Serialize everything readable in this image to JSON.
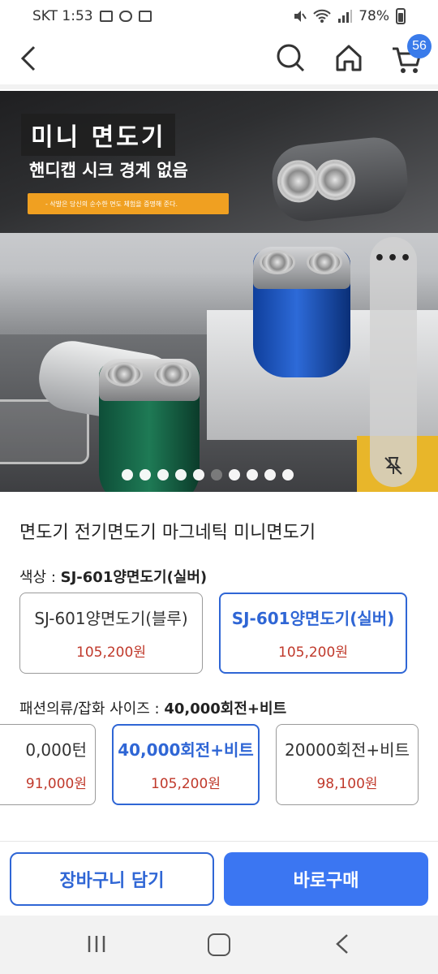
{
  "status_bar": {
    "carrier_time": "SKT 1:53",
    "battery": "78%"
  },
  "header": {
    "cart_count": "56"
  },
  "banner": {
    "title": "미니 면도기",
    "subtitle": "핸디캡 시크 경계 없음",
    "tagline": "- 삭발은 당신의 순수한 면도 체험을 증명해 준다.",
    "more_menu": "•••",
    "carousel_active_index": 5,
    "carousel_total": 10
  },
  "product": {
    "title": "면도기 전기면도기 마그네틱 미니면도기"
  },
  "color_option": {
    "label": "색상 : ",
    "selected": "SJ-601양면도기(실버)",
    "choices": [
      {
        "name": "SJ-601양면도기(블루)",
        "price": "105,200원"
      },
      {
        "name": "SJ-601양면도기(실버)",
        "price": "105,200원"
      }
    ]
  },
  "size_option": {
    "label": "패션의류/잡화 사이즈 : ",
    "selected": "40,000회전+비트",
    "choices": [
      {
        "name": "0,000턴",
        "price": "91,000원"
      },
      {
        "name": "40,000회전+비트",
        "price": "105,200원"
      },
      {
        "name": "20000회전+비트",
        "price": "98,100원"
      }
    ]
  },
  "actions": {
    "add_to_cart": "장바구니 담기",
    "buy_now": "바로구매"
  },
  "colors": {
    "accent": "#2f66d5",
    "buy_button": "#3b76f2",
    "price": "#c0392b",
    "badge": "#3a7bea"
  }
}
